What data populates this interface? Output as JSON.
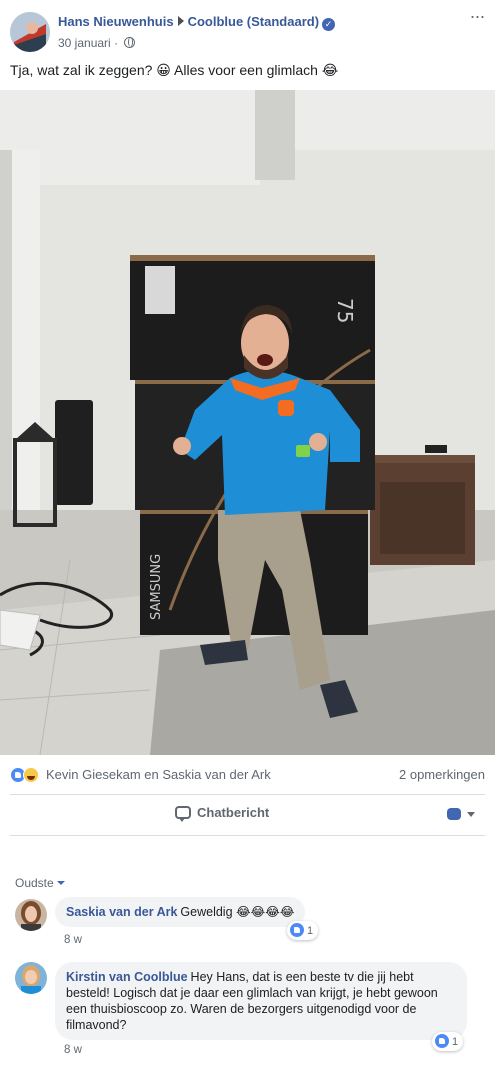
{
  "post": {
    "author": "Hans Nieuwenhuis",
    "target": "Coolblue (Standaard)",
    "date": "30 januari",
    "date_separator": "·",
    "text": "Tja, wat zal ik zeggen? 😀 Alles voor een glimlach 😂"
  },
  "photo": {
    "box_text": "SAMSUNG",
    "box_size": "75"
  },
  "reactions": {
    "names": "Kevin Giesekam en Saskia van der Ark",
    "comment_count": "2 opmerkingen"
  },
  "actions": {
    "chat_label": "Chatbericht"
  },
  "comments_section": {
    "sort_label": "Oudste"
  },
  "comments": [
    {
      "author": "Saskia van der Ark",
      "text": "Geweldig 😂😂😂😂",
      "time": "8 w",
      "reaction_count": "1"
    },
    {
      "author": "Kirstin van Coolblue",
      "text": "Hey Hans, dat is een beste tv die jij hebt besteld! Logisch dat je daar een glimlach van krijgt, je hebt gewoon een thuisbioscoop zo. Waren de bezorgers uitgenodigd voor de filmavond?",
      "time": "8 w",
      "reaction_count": "1"
    }
  ],
  "icons": {
    "verified": "verified-badge-icon",
    "privacy": "globe-icon",
    "more": "more-options-icon",
    "like": "like-reaction-icon",
    "haha": "haha-reaction-icon",
    "chat": "chat-bubble-icon"
  },
  "colors": {
    "link_blue": "#385898",
    "brand_blue": "#4267b2",
    "secondary_text": "#606770",
    "bubble_bg": "#f2f3f5",
    "jacket_blue": "#1e8fd6",
    "collar_orange": "#f36c21"
  }
}
